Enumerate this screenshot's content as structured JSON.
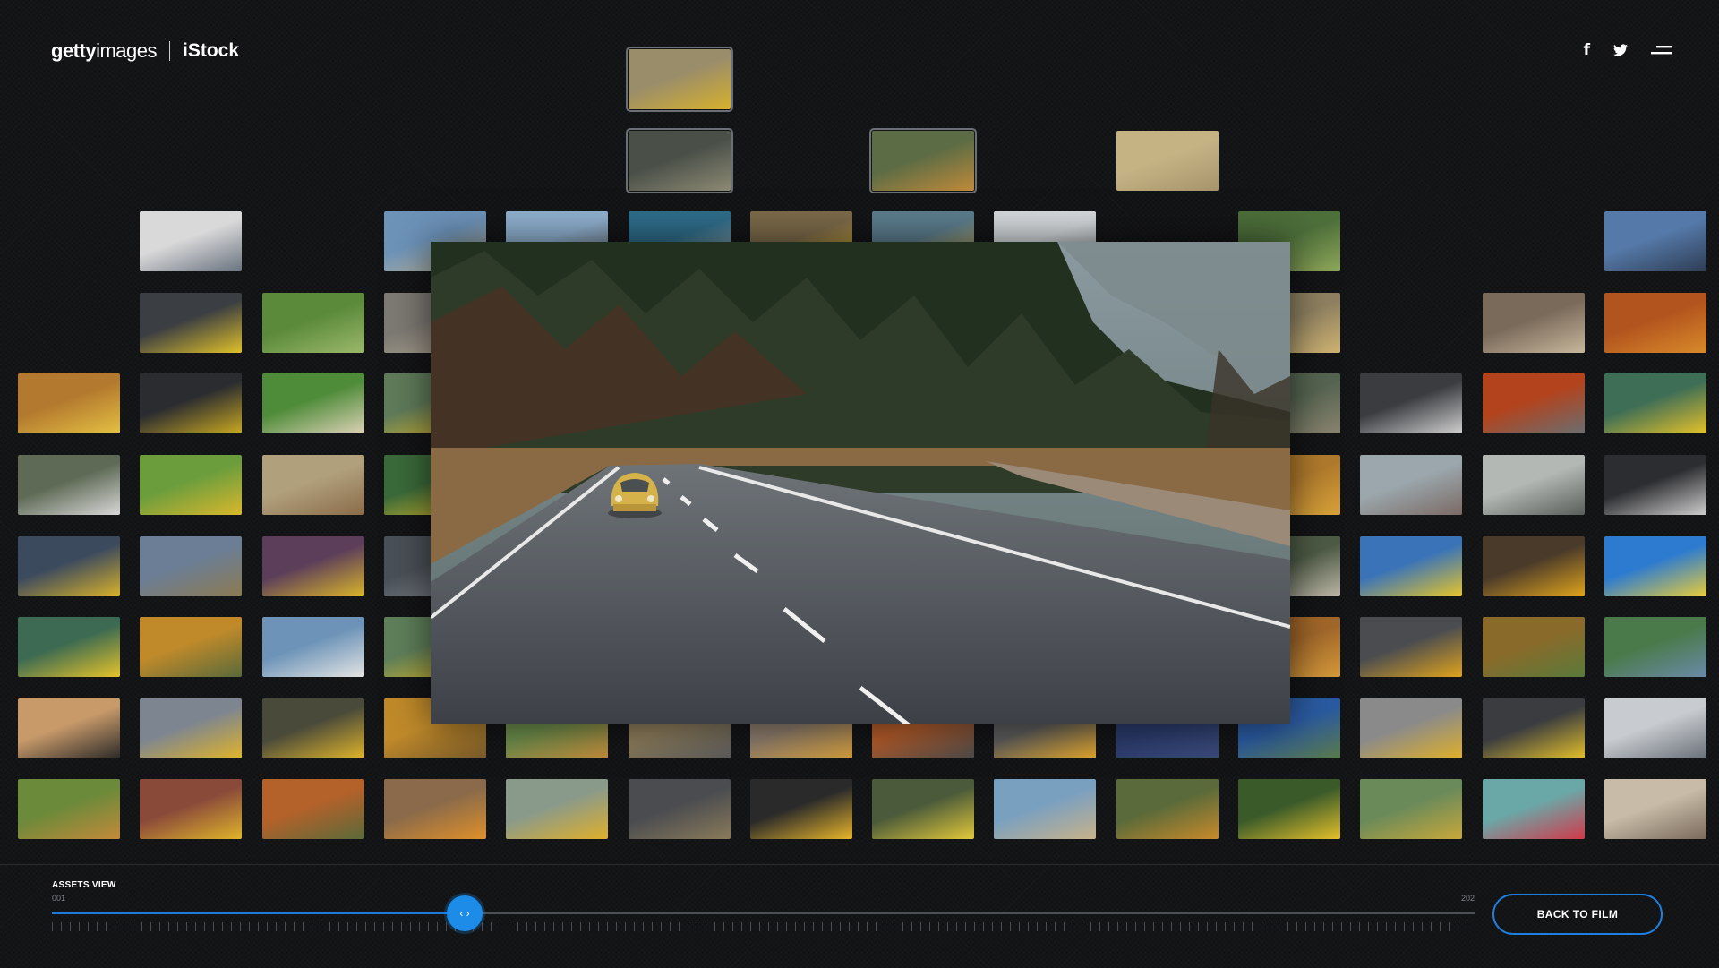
{
  "brand": {
    "getty_bold": "getty",
    "getty_rest": "images",
    "istock": "iStock"
  },
  "social": {
    "facebook_glyph": "f",
    "icons": [
      "facebook-icon",
      "twitter-icon",
      "menu-icon"
    ]
  },
  "footer": {
    "section_label": "ASSETS VIEW",
    "range_start": "001",
    "range_end": "202",
    "back_button": "BACK TO FILM",
    "slider_position_fraction": 0.29,
    "accent_color": "#1d8be8"
  },
  "preview": {
    "subject": "yellow-beetle-forest-road"
  },
  "tiles": [
    {
      "col": 5,
      "row": 0,
      "c1": "#9a8d6a",
      "c2": "#d7b12c",
      "sel": true
    },
    {
      "col": 5,
      "row": 1,
      "c1": "#4a5048",
      "c2": "#8d8a74",
      "sel": true
    },
    {
      "col": 7,
      "row": 1,
      "c1": "#5c6c45",
      "c2": "#c08a3a",
      "sel": true
    },
    {
      "col": 9,
      "row": 1,
      "c1": "#c6b384",
      "c2": "#a7946b"
    },
    {
      "col": 1,
      "row": 2,
      "c1": "#d9d9d9",
      "c2": "#6a7380"
    },
    {
      "col": 3,
      "row": 2,
      "c1": "#6d93b9",
      "c2": "#c4b89a"
    },
    {
      "col": 4,
      "row": 2,
      "c1": "#8fb0cf",
      "c2": "#6b6f73"
    },
    {
      "col": 5,
      "row": 2,
      "c1": "#2f6d8a",
      "c2": "#aab4b4"
    },
    {
      "col": 6,
      "row": 2,
      "c1": "#7c6a4a",
      "c2": "#e1b92b"
    },
    {
      "col": 7,
      "row": 2,
      "c1": "#5c7d8e",
      "c2": "#d7b54a"
    },
    {
      "col": 8,
      "row": 2,
      "c1": "#d5d9dc",
      "c2": "#9aa0a4"
    },
    {
      "col": 10,
      "row": 2,
      "c1": "#4d6f3a",
      "c2": "#8fa85a"
    },
    {
      "col": 13,
      "row": 2,
      "c1": "#5579a8",
      "c2": "#2e3d55"
    },
    {
      "col": 1,
      "row": 3,
      "c1": "#3b3e42",
      "c2": "#e0c12a"
    },
    {
      "col": 2,
      "row": 3,
      "c1": "#5a8a3a",
      "c2": "#9cb86a"
    },
    {
      "col": 3,
      "row": 3,
      "c1": "#7d7a73",
      "c2": "#b4aa95"
    },
    {
      "col": 10,
      "row": 3,
      "c1": "#8e8060",
      "c2": "#cfb372"
    },
    {
      "col": 12,
      "row": 3,
      "c1": "#7a6a5a",
      "c2": "#c7b79c"
    },
    {
      "col": 13,
      "row": 3,
      "c1": "#b2541e",
      "c2": "#d88a2a"
    },
    {
      "col": 0,
      "row": 4,
      "c1": "#b3792e",
      "c2": "#e4c043"
    },
    {
      "col": 1,
      "row": 4,
      "c1": "#2b2c30",
      "c2": "#c9a821"
    },
    {
      "col": 2,
      "row": 4,
      "c1": "#4f8c3a",
      "c2": "#dcd1b5"
    },
    {
      "col": 3,
      "row": 4,
      "c1": "#5f7b5a",
      "c2": "#e0bc2a"
    },
    {
      "col": 10,
      "row": 4,
      "c1": "#556450",
      "c2": "#8a8470"
    },
    {
      "col": 11,
      "row": 4,
      "c1": "#3a3c40",
      "c2": "#cfcfcf"
    },
    {
      "col": 12,
      "row": 4,
      "c1": "#b3431c",
      "c2": "#6b6d70"
    },
    {
      "col": 13,
      "row": 4,
      "c1": "#3f6e56",
      "c2": "#e4c12a"
    },
    {
      "col": 0,
      "row": 5,
      "c1": "#5e6a55",
      "c2": "#d8d8d8"
    },
    {
      "col": 1,
      "row": 5,
      "c1": "#6c9d3d",
      "c2": "#d9b82c"
    },
    {
      "col": 2,
      "row": 5,
      "c1": "#b1a07c",
      "c2": "#8a6c4a"
    },
    {
      "col": 3,
      "row": 5,
      "c1": "#3a6a3a",
      "c2": "#e0c12a"
    },
    {
      "col": 10,
      "row": 5,
      "c1": "#b07a2c",
      "c2": "#d8a23a"
    },
    {
      "col": 11,
      "row": 5,
      "c1": "#9ba7ac",
      "c2": "#7b6a66"
    },
    {
      "col": 12,
      "row": 5,
      "c1": "#b3b8b5",
      "c2": "#5a5e5a"
    },
    {
      "col": 13,
      "row": 5,
      "c1": "#2c2d30",
      "c2": "#cfcfcf"
    },
    {
      "col": 0,
      "row": 6,
      "c1": "#3c4a5e",
      "c2": "#d8b12a"
    },
    {
      "col": 1,
      "row": 6,
      "c1": "#6b7e96",
      "c2": "#8c7a52"
    },
    {
      "col": 2,
      "row": 6,
      "c1": "#5c3e5a",
      "c2": "#dab52a"
    },
    {
      "col": 3,
      "row": 6,
      "c1": "#4a5057",
      "c2": "#7f858c"
    },
    {
      "col": 10,
      "row": 6,
      "c1": "#4d5a44",
      "c2": "#bcb6a6"
    },
    {
      "col": 11,
      "row": 6,
      "c1": "#3a73b8",
      "c2": "#e5c52a"
    },
    {
      "col": 12,
      "row": 6,
      "c1": "#4a3a2a",
      "c2": "#e0a41c"
    },
    {
      "col": 13,
      "row": 6,
      "c1": "#2d7bd0",
      "c2": "#e7cd3a"
    },
    {
      "col": 0,
      "row": 7,
      "c1": "#3c6a52",
      "c2": "#e5c32a"
    },
    {
      "col": 1,
      "row": 7,
      "c1": "#c08a2a",
      "c2": "#5a6a3a"
    },
    {
      "col": 2,
      "row": 7,
      "c1": "#6d94b8",
      "c2": "#e4e4e4"
    },
    {
      "col": 3,
      "row": 7,
      "c1": "#5f7f5a",
      "c2": "#e0c02a"
    },
    {
      "col": 10,
      "row": 7,
      "c1": "#a0662a",
      "c2": "#d49a3a"
    },
    {
      "col": 11,
      "row": 7,
      "c1": "#4a4c50",
      "c2": "#e0a31c"
    },
    {
      "col": 12,
      "row": 7,
      "c1": "#8a6a2a",
      "c2": "#5a7a3a"
    },
    {
      "col": 13,
      "row": 7,
      "c1": "#4a7a4a",
      "c2": "#6a8aa8"
    },
    {
      "col": 0,
      "row": 8,
      "c1": "#c89a6a",
      "c2": "#2c2a28"
    },
    {
      "col": 1,
      "row": 8,
      "c1": "#7d8590",
      "c2": "#e1b42a"
    },
    {
      "col": 2,
      "row": 8,
      "c1": "#4a4a3a",
      "c2": "#e0b52a"
    },
    {
      "col": 3,
      "row": 8,
      "c1": "#c08a2a",
      "c2": "#7a5a2a"
    },
    {
      "col": 4,
      "row": 8,
      "c1": "#6a8a4a",
      "c2": "#c28a3a"
    },
    {
      "col": 5,
      "row": 8,
      "c1": "#8a7a5a",
      "c2": "#5a5a5a"
    },
    {
      "col": 6,
      "row": 8,
      "c1": "#8a7a6a",
      "c2": "#d09a3a"
    },
    {
      "col": 7,
      "row": 8,
      "c1": "#b05a2a",
      "c2": "#4a4a4a"
    },
    {
      "col": 8,
      "row": 8,
      "c1": "#5a5a5a",
      "c2": "#e0a42a"
    },
    {
      "col": 9,
      "row": 8,
      "c1": "#2a3a6a",
      "c2": "#3a4a7a"
    },
    {
      "col": 10,
      "row": 8,
      "c1": "#2a5aa0",
      "c2": "#5a7a4a"
    },
    {
      "col": 11,
      "row": 8,
      "c1": "#8a8a8a",
      "c2": "#e0b02a"
    },
    {
      "col": 12,
      "row": 8,
      "c1": "#3a3c40",
      "c2": "#e4c02a"
    },
    {
      "col": 13,
      "row": 8,
      "c1": "#c8ccd0",
      "c2": "#6a7078"
    },
    {
      "col": 0,
      "row": 9,
      "c1": "#6b8a3a",
      "c2": "#c28a3a"
    },
    {
      "col": 1,
      "row": 9,
      "c1": "#8a4a3a",
      "c2": "#e0b42a"
    },
    {
      "col": 2,
      "row": 9,
      "c1": "#b5612a",
      "c2": "#5a6a3a"
    },
    {
      "col": 3,
      "row": 9,
      "c1": "#8a6a4a",
      "c2": "#e0902a"
    },
    {
      "col": 4,
      "row": 9,
      "c1": "#8a9a8a",
      "c2": "#e0b02a"
    },
    {
      "col": 5,
      "row": 9,
      "c1": "#4a4c50",
      "c2": "#8a7a5a"
    },
    {
      "col": 6,
      "row": 9,
      "c1": "#2a2a2a",
      "c2": "#e8b52a"
    },
    {
      "col": 7,
      "row": 9,
      "c1": "#4a5a3a",
      "c2": "#e2c83a"
    },
    {
      "col": 8,
      "row": 9,
      "c1": "#7aa0c0",
      "c2": "#c8b28a"
    },
    {
      "col": 9,
      "row": 9,
      "c1": "#5a6a3a",
      "c2": "#c88a2a"
    },
    {
      "col": 10,
      "row": 9,
      "c1": "#3a5a2a",
      "c2": "#e4c02a"
    },
    {
      "col": 11,
      "row": 9,
      "c1": "#6a8a5a",
      "c2": "#c8a83a"
    },
    {
      "col": 12,
      "row": 9,
      "c1": "#6aa8a8",
      "c2": "#d03a4a"
    },
    {
      "col": 13,
      "row": 9,
      "c1": "#c8bca8",
      "c2": "#7a6a5a"
    }
  ]
}
